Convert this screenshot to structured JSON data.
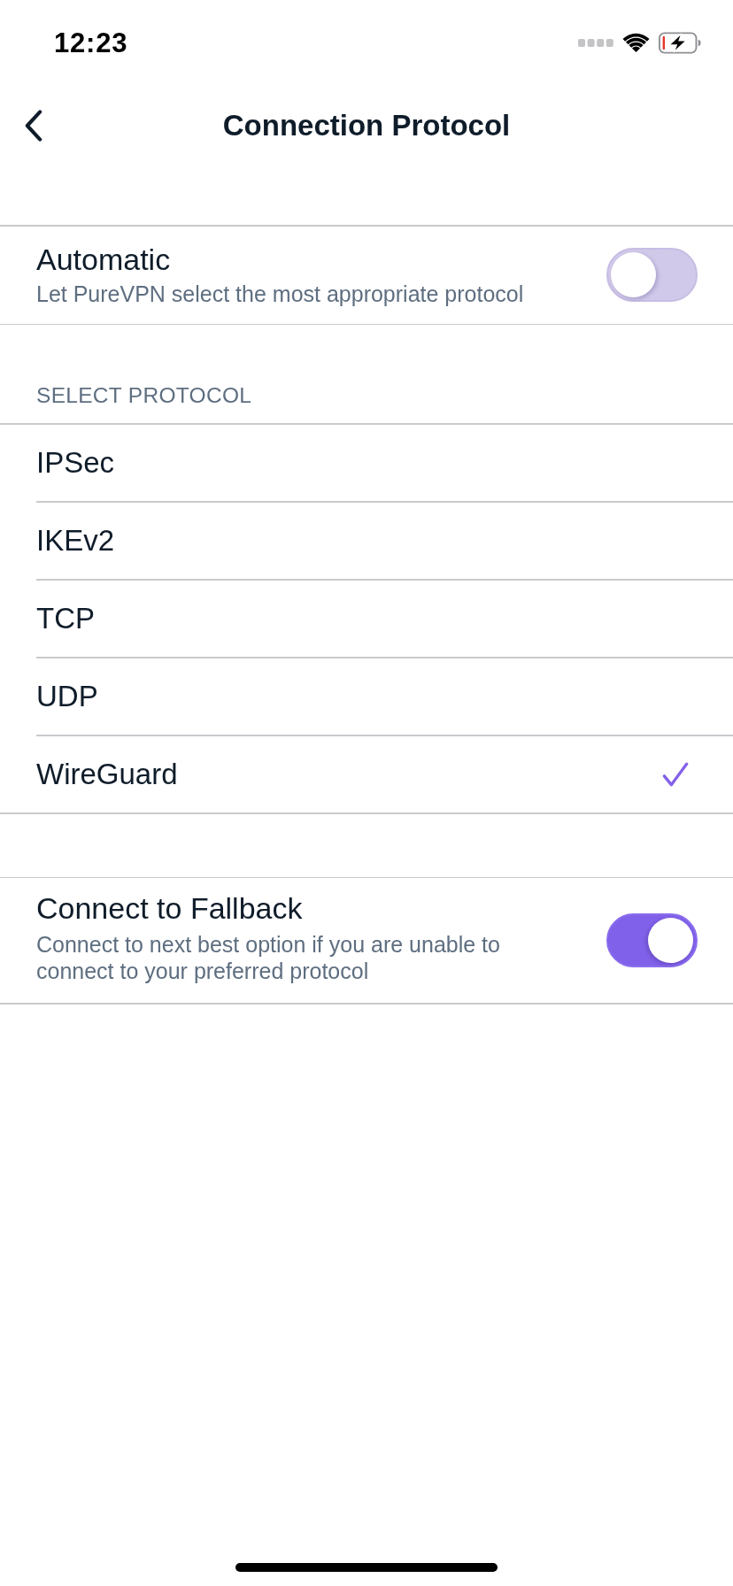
{
  "status_bar": {
    "time": "12:23"
  },
  "nav": {
    "title": "Connection Protocol"
  },
  "automatic": {
    "title": "Automatic",
    "subtitle": "Let PureVPN select the most appropriate protocol",
    "on": false
  },
  "protocols": {
    "header": "SELECT PROTOCOL",
    "items": [
      {
        "label": "IPSec",
        "selected": false
      },
      {
        "label": "IKEv2",
        "selected": false
      },
      {
        "label": "TCP",
        "selected": false
      },
      {
        "label": "UDP",
        "selected": false
      },
      {
        "label": "WireGuard",
        "selected": true
      }
    ]
  },
  "fallback": {
    "title": "Connect to Fallback",
    "subtitle": "Connect to next best option if you are unable to connect to your preferred protocol",
    "on": true
  }
}
